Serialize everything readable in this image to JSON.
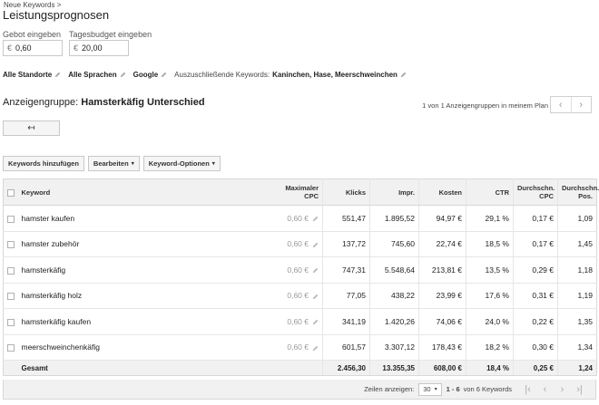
{
  "breadcrumb": "Neue Keywords >",
  "page_title": "Leistungsprognosen",
  "bid": {
    "label": "Gebot eingeben",
    "currency": "€",
    "value": "0,60"
  },
  "budget": {
    "label": "Tagesbudget eingeben",
    "currency": "€",
    "value": "20,00"
  },
  "filters": {
    "locations": "Alle Standorte",
    "languages": "Alle Sprachen",
    "network": "Google",
    "negatives_label": "Auszuschließende Keywords:",
    "negatives_value": "Kaninchen, Hase, Meerschweinchen"
  },
  "adgroup": {
    "label": "Anzeigengruppe:",
    "name": "Hamsterkäfig Unterschied"
  },
  "pager": {
    "info": "1 von 1 Anzeigengruppen in meinem Plan",
    "prev": "‹",
    "next": "›"
  },
  "back_button": "↤",
  "toolbar": {
    "add_keywords": "Keywords hinzufügen",
    "edit": "Bearbeiten",
    "keyword_options": "Keyword-Optionen",
    "caret": "▾"
  },
  "table": {
    "headers": {
      "keyword": "Keyword",
      "max_cpc_1": "Maximaler",
      "max_cpc_2": "CPC",
      "clicks": "Klicks",
      "impr": "Impr.",
      "cost": "Kosten",
      "ctr": "CTR",
      "avg_cpc_1": "Durchschn.",
      "avg_cpc_2": "CPC",
      "avg_pos_1": "Durchschn.",
      "avg_pos_2": "Pos."
    },
    "rows": [
      {
        "keyword": "hamster kaufen",
        "max_cpc": "0,60 €",
        "clicks": "551,47",
        "impr": "1.895,52",
        "cost": "94,97 €",
        "ctr": "29,1 %",
        "avg_cpc": "0,17 €",
        "avg_pos": "1,09"
      },
      {
        "keyword": "hamster zubehör",
        "max_cpc": "0,60 €",
        "clicks": "137,72",
        "impr": "745,60",
        "cost": "22,74 €",
        "ctr": "18,5 %",
        "avg_cpc": "0,17 €",
        "avg_pos": "1,45"
      },
      {
        "keyword": "hamsterkäfig",
        "max_cpc": "0,60 €",
        "clicks": "747,31",
        "impr": "5.548,64",
        "cost": "213,81 €",
        "ctr": "13,5 %",
        "avg_cpc": "0,29 €",
        "avg_pos": "1,18"
      },
      {
        "keyword": "hamsterkäfig holz",
        "max_cpc": "0,60 €",
        "clicks": "77,05",
        "impr": "438,22",
        "cost": "23,99 €",
        "ctr": "17,6 %",
        "avg_cpc": "0,31 €",
        "avg_pos": "1,19"
      },
      {
        "keyword": "hamsterkäfig kaufen",
        "max_cpc": "0,60 €",
        "clicks": "341,19",
        "impr": "1.420,26",
        "cost": "74,06 €",
        "ctr": "24,0 %",
        "avg_cpc": "0,22 €",
        "avg_pos": "1,35"
      },
      {
        "keyword": "meerschweinchenkäfig",
        "max_cpc": "0,60 €",
        "clicks": "601,57",
        "impr": "3.307,12",
        "cost": "178,43 €",
        "ctr": "18,2 %",
        "avg_cpc": "0,30 €",
        "avg_pos": "1,34"
      }
    ],
    "total": {
      "label": "Gesamt",
      "clicks": "2.456,30",
      "impr": "13.355,35",
      "cost": "608,00 €",
      "ctr": "18,4 %",
      "avg_cpc": "0,25 €",
      "avg_pos": "1,24"
    }
  },
  "footer": {
    "rows_label": "Zeilen anzeigen:",
    "rows_value": "30",
    "range": "1 - 6",
    "range_suffix": "von 6 Keywords",
    "first": "|‹",
    "prev": "‹",
    "next": "›",
    "last": "›|"
  }
}
